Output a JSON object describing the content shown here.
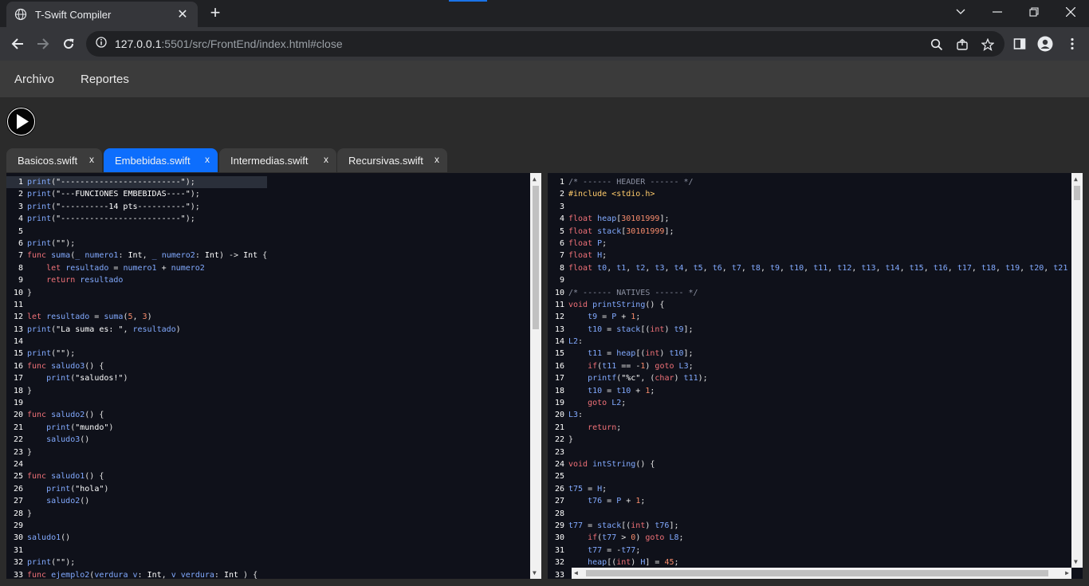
{
  "browser": {
    "tab_title": "T-Swift Compiler",
    "tab_close": "✕",
    "new_tab": "+",
    "url_host": "127.0.0.1",
    "url_path": ":5501/src/FrontEnd/index.html#close"
  },
  "app": {
    "menu": [
      "Archivo",
      "Reportes"
    ]
  },
  "file_tabs": [
    {
      "label": "Basicos.swift",
      "close": "x",
      "active": false
    },
    {
      "label": "Embebidas.swift",
      "close": "x",
      "active": true
    },
    {
      "label": "Intermedias.swift",
      "close": "x",
      "active": false
    },
    {
      "label": "Recursivas.swift",
      "close": "x",
      "active": false
    }
  ],
  "source_editor": {
    "lines": [
      {
        "n": "1",
        "code": "print(\"-------------------------\");"
      },
      {
        "n": "2",
        "code": "print(\"---FUNCIONES EMBEBIDAS----\");"
      },
      {
        "n": "3",
        "code": "print(\"----------14 pts----------\");"
      },
      {
        "n": "4",
        "code": "print(\"-------------------------\");"
      },
      {
        "n": "5",
        "code": ""
      },
      {
        "n": "6",
        "code": "print(\"\");"
      },
      {
        "n": "7",
        "code": "func suma(_ numero1: Int, _ numero2: Int) -> Int {"
      },
      {
        "n": "8",
        "code": "    let resultado = numero1 + numero2"
      },
      {
        "n": "9",
        "code": "    return resultado"
      },
      {
        "n": "10",
        "code": "}"
      },
      {
        "n": "11",
        "code": ""
      },
      {
        "n": "12",
        "code": "let resultado = suma(5, 3)"
      },
      {
        "n": "13",
        "code": "print(\"La suma es: \", resultado)"
      },
      {
        "n": "14",
        "code": ""
      },
      {
        "n": "15",
        "code": "print(\"\");"
      },
      {
        "n": "16",
        "code": "func saludo3() {"
      },
      {
        "n": "17",
        "code": "    print(\"saludos!\")"
      },
      {
        "n": "18",
        "code": "}"
      },
      {
        "n": "19",
        "code": ""
      },
      {
        "n": "20",
        "code": "func saludo2() {"
      },
      {
        "n": "21",
        "code": "    print(\"mundo\")"
      },
      {
        "n": "22",
        "code": "    saludo3()"
      },
      {
        "n": "23",
        "code": "}"
      },
      {
        "n": "24",
        "code": ""
      },
      {
        "n": "25",
        "code": "func saludo1() {"
      },
      {
        "n": "26",
        "code": "    print(\"hola\")"
      },
      {
        "n": "27",
        "code": "    saludo2()"
      },
      {
        "n": "28",
        "code": "}"
      },
      {
        "n": "29",
        "code": ""
      },
      {
        "n": "30",
        "code": "saludo1()"
      },
      {
        "n": "31",
        "code": ""
      },
      {
        "n": "32",
        "code": "print(\"\");"
      },
      {
        "n": "33",
        "code": "func ejemplo2(verdura v: Int, v verdura: Int ) {"
      }
    ]
  },
  "output_editor": {
    "lines": [
      {
        "n": "1",
        "code": "/* ------ HEADER ------ */"
      },
      {
        "n": "2",
        "code": "#include <stdio.h>"
      },
      {
        "n": "3",
        "code": ""
      },
      {
        "n": "4",
        "code": "float heap[30101999];"
      },
      {
        "n": "5",
        "code": "float stack[30101999];"
      },
      {
        "n": "6",
        "code": "float P;"
      },
      {
        "n": "7",
        "code": "float H;"
      },
      {
        "n": "8",
        "code": "float t0, t1, t2, t3, t4, t5, t6, t7, t8, t9, t10, t11, t12, t13, t14, t15, t16, t17, t18, t19, t20, t21"
      },
      {
        "n": "9",
        "code": ""
      },
      {
        "n": "10",
        "code": "/* ------ NATIVES ------ */"
      },
      {
        "n": "11",
        "code": "void printString() {"
      },
      {
        "n": "12",
        "code": "    t9 = P + 1;"
      },
      {
        "n": "13",
        "code": "    t10 = stack[(int) t9];"
      },
      {
        "n": "14",
        "code": "L2:"
      },
      {
        "n": "15",
        "code": "    t11 = heap[(int) t10];"
      },
      {
        "n": "16",
        "code": "    if(t11 == -1) goto L3;"
      },
      {
        "n": "17",
        "code": "    printf(\"%c\", (char) t11);"
      },
      {
        "n": "18",
        "code": "    t10 = t10 + 1;"
      },
      {
        "n": "19",
        "code": "    goto L2;"
      },
      {
        "n": "20",
        "code": "L3:"
      },
      {
        "n": "21",
        "code": "    return;"
      },
      {
        "n": "22",
        "code": "}"
      },
      {
        "n": "23",
        "code": ""
      },
      {
        "n": "24",
        "code": "void intString() {"
      },
      {
        "n": "25",
        "code": ""
      },
      {
        "n": "26",
        "code": "t75 = H;"
      },
      {
        "n": "27",
        "code": "    t76 = P + 1;"
      },
      {
        "n": "28",
        "code": ""
      },
      {
        "n": "29",
        "code": "t77 = stack[(int) t76];"
      },
      {
        "n": "30",
        "code": "    if(t77 > 0) goto L8;"
      },
      {
        "n": "31",
        "code": "    t77 = -t77;"
      },
      {
        "n": "32",
        "code": "    heap[(int) H] = 45;"
      },
      {
        "n": "33",
        "code": ""
      }
    ]
  },
  "colors": {
    "accent": "#0d6efd",
    "editor_bg": "#0f111a",
    "menubar_bg": "#3b3b3b"
  }
}
